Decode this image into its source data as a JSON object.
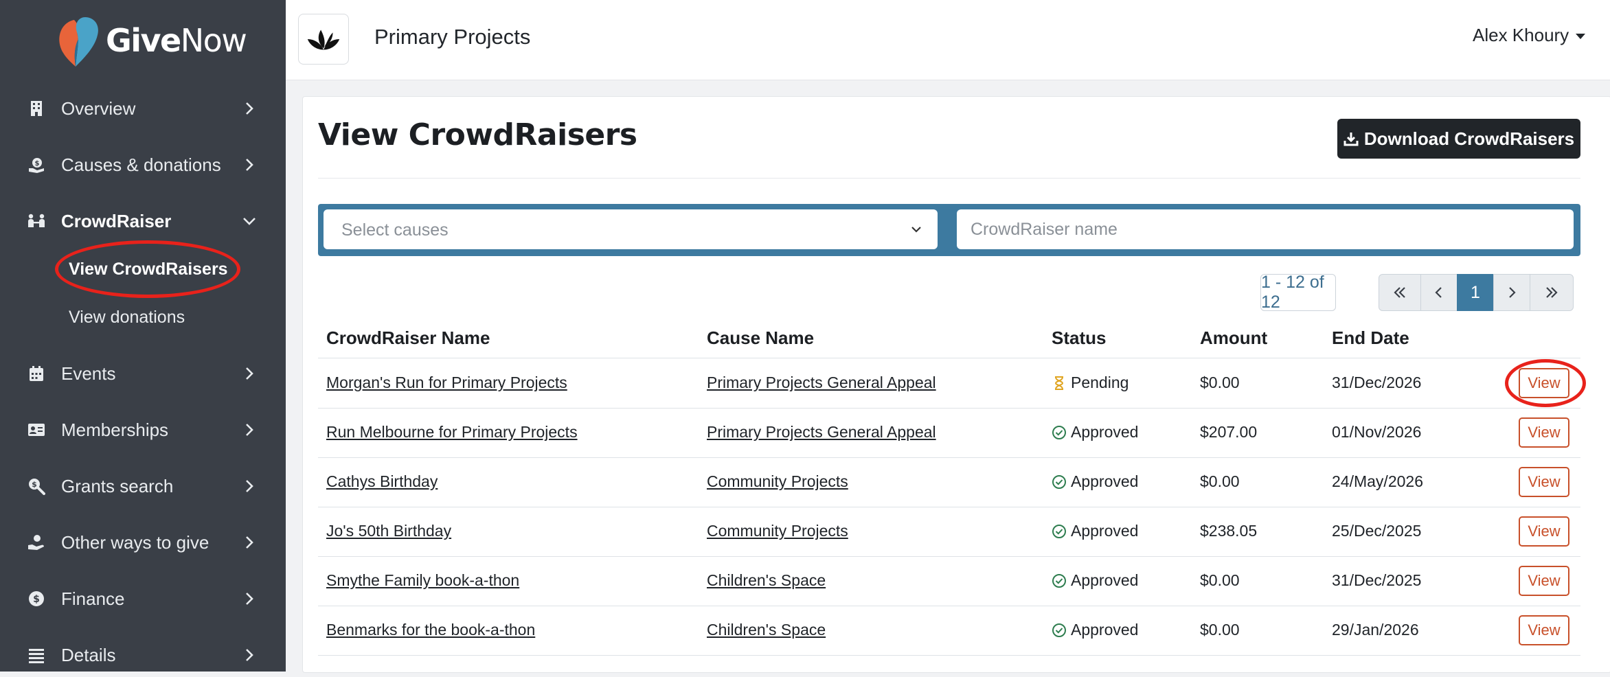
{
  "app": {
    "logo": {
      "bold": "Give",
      "light": "Now"
    },
    "org_name": "Primary Projects",
    "user_name": "Alex Khoury"
  },
  "sidebar": {
    "items": [
      {
        "label": "Overview",
        "icon": "building-icon"
      },
      {
        "label": "Causes & donations",
        "icon": "donation-icon"
      },
      {
        "label": "CrowdRaiser",
        "icon": "people-icon",
        "expanded": true
      },
      {
        "label": "Events",
        "icon": "calendar-icon"
      },
      {
        "label": "Memberships",
        "icon": "id-card-icon"
      },
      {
        "label": "Grants search",
        "icon": "search-dollar-icon"
      },
      {
        "label": "Other ways to give",
        "icon": "hand-giving-icon"
      },
      {
        "label": "Finance",
        "icon": "dollar-coin-icon"
      },
      {
        "label": "Details",
        "icon": "list-icon"
      }
    ],
    "sub_items": [
      {
        "label": "View CrowdRaisers",
        "active": true
      },
      {
        "label": "View donations",
        "active": false
      }
    ]
  },
  "main": {
    "title": "View CrowdRaisers",
    "download_label": "Download CrowdRaisers",
    "filters": {
      "causes_placeholder": "Select causes",
      "name_placeholder": "CrowdRaiser name"
    },
    "pagination": {
      "range": "1 - 12 of 12",
      "current_page": "1"
    },
    "table": {
      "headers": [
        "CrowdRaiser Name",
        "Cause Name",
        "Status",
        "Amount",
        "End Date"
      ],
      "rows": [
        {
          "name": "Morgan's Run for Primary Projects",
          "cause": "Primary Projects General Appeal",
          "status": "Pending",
          "amount": "$0.00",
          "end_date": "31/Dec/2026",
          "action": "View"
        },
        {
          "name": "Run Melbourne for Primary Projects",
          "cause": "Primary Projects General Appeal",
          "status": "Approved",
          "amount": "$207.00",
          "end_date": "01/Nov/2026",
          "action": "View"
        },
        {
          "name": "Cathys Birthday",
          "cause": "Community Projects",
          "status": "Approved",
          "amount": "$0.00",
          "end_date": "24/May/2026",
          "action": "View"
        },
        {
          "name": "Jo's 50th Birthday",
          "cause": "Community Projects",
          "status": "Approved",
          "amount": "$238.05",
          "end_date": "25/Dec/2025",
          "action": "View"
        },
        {
          "name": "Smythe Family book-a-thon",
          "cause": "Children's Space",
          "status": "Approved",
          "amount": "$0.00",
          "end_date": "31/Dec/2025",
          "action": "View"
        },
        {
          "name": "Benmarks for the book-a-thon",
          "cause": "Children's Space",
          "status": "Approved",
          "amount": "$0.00",
          "end_date": "29/Jan/2026",
          "action": "View"
        }
      ]
    }
  },
  "colors": {
    "sidebar_bg": "#3a3f47",
    "accent": "#3d7aa0",
    "view_button": "#c8502a",
    "highlight_ring": "#e8221b",
    "approved": "#2e7d4f",
    "pending": "#e0a420"
  }
}
